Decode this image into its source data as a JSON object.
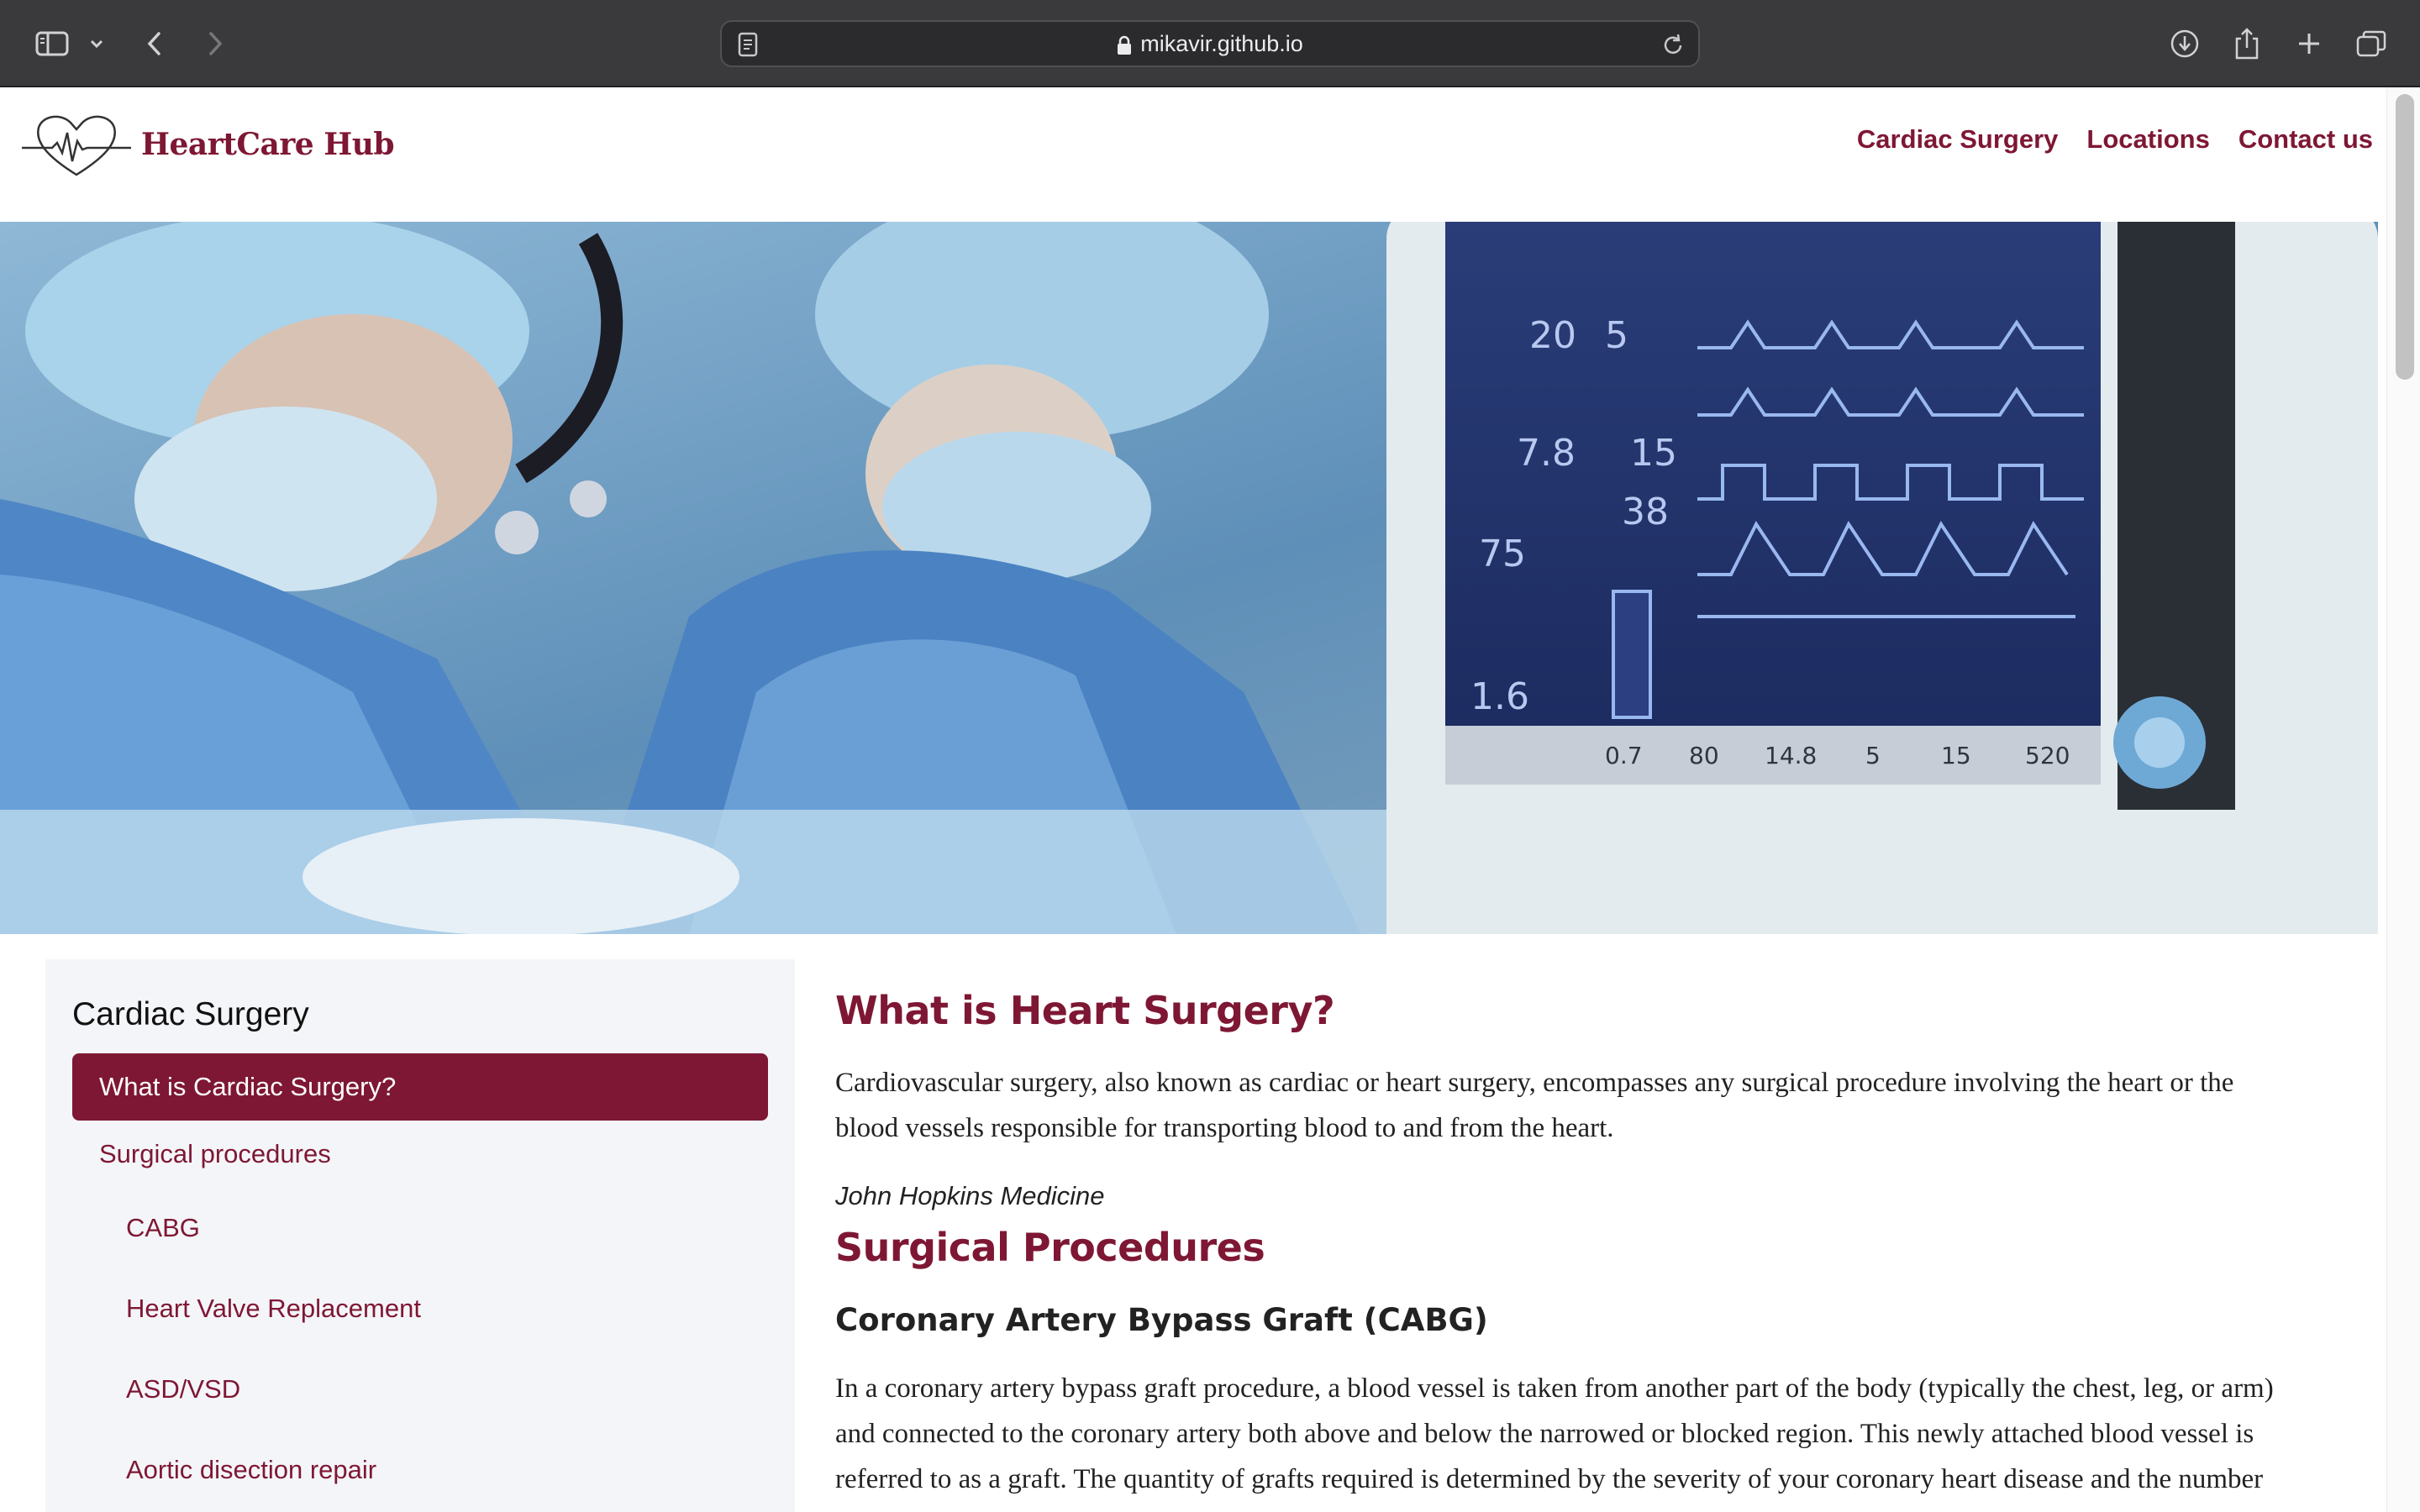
{
  "browser": {
    "url": "mikavir.github.io",
    "icons": [
      "sidebar-icon",
      "chevron-down-icon",
      "back-icon",
      "forward-icon",
      "reader-icon",
      "lock-icon",
      "reload-icon",
      "download-icon",
      "share-icon",
      "new-tab-icon",
      "tabs-overview-icon"
    ]
  },
  "site": {
    "logo_text": "HeartCare Hub",
    "nav": [
      "Cardiac Surgery",
      "Locations",
      "Contact us"
    ],
    "brand_color": "#7e1734"
  },
  "sidebar": {
    "title": "Cardiac Surgery",
    "items": [
      {
        "label": "What is Cardiac Surgery?",
        "active": true
      },
      {
        "label": "Surgical procedures",
        "active": false
      },
      {
        "label": "CABG",
        "active": false
      },
      {
        "label": "Heart Valve Replacement",
        "active": false
      },
      {
        "label": "ASD/VSD",
        "active": false
      },
      {
        "label": "Aortic disection repair",
        "active": false
      }
    ]
  },
  "main": {
    "heading": "What is Heart Surgery?",
    "intro_lines": [
      "Cardiovascular surgery, also known as cardiac or heart surgery, encompasses any surgical procedure involving the heart or the",
      "blood vessels responsible for transporting blood to and from the heart."
    ],
    "citation": "John Hopkins Medicine",
    "section_heading": "Surgical Procedures",
    "subheading": "Coronary Artery Bypass Graft (CABG)",
    "cabg_lines": [
      "In a coronary artery bypass graft procedure, a blood vessel is taken from another part of the body (typically the chest, leg, or arm)",
      "and connected to the coronary artery both above and below the narrowed or blocked region.  This newly attached blood vessel is",
      "referred to as a graft. The quantity of grafts required is determined by the severity of your coronary heart disease and the number"
    ]
  }
}
